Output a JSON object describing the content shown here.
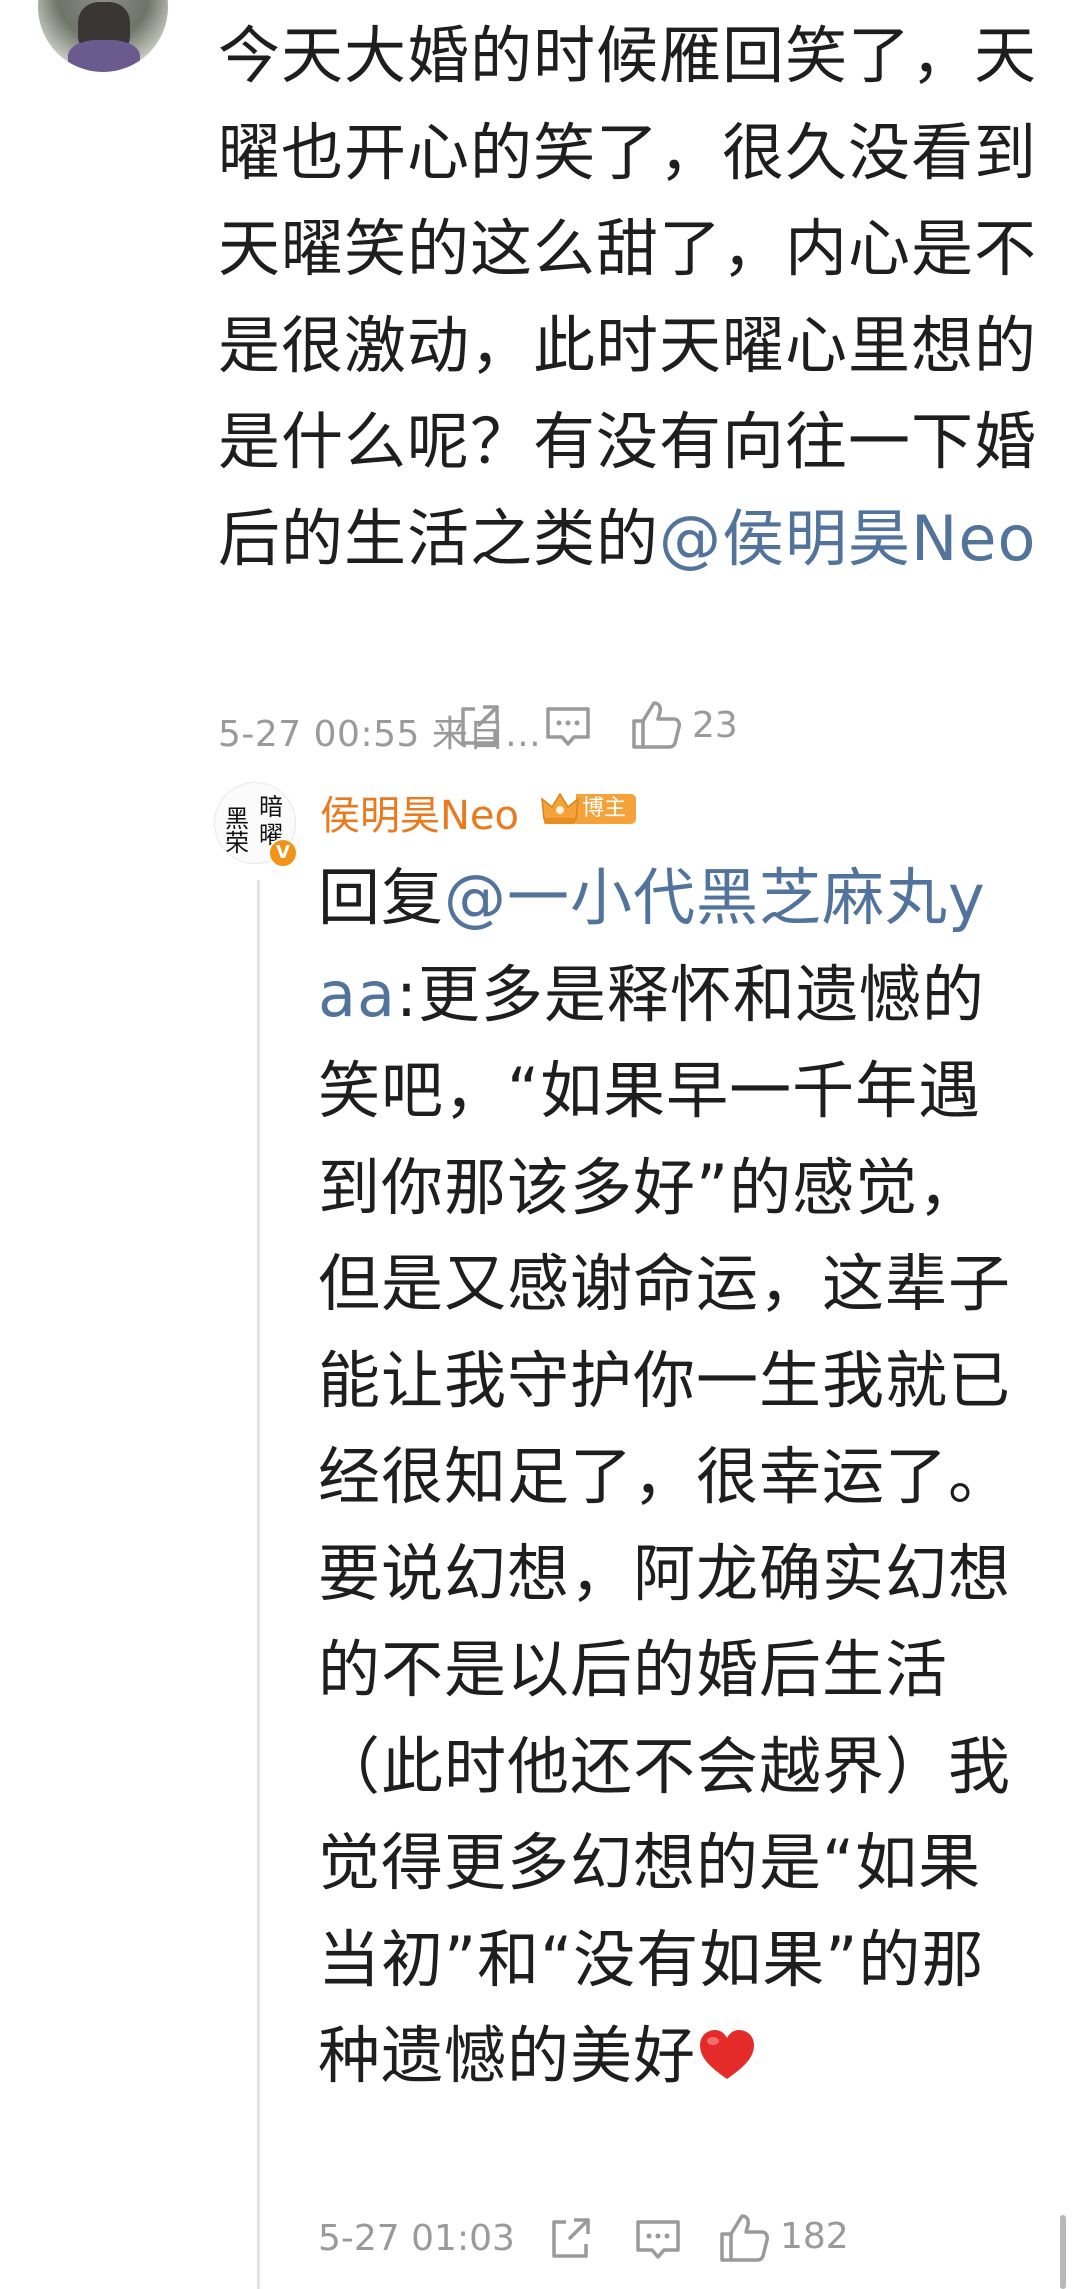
{
  "comment": {
    "text": "今天大婚的时候雁回笑了，天曜也开心的笑了，很久没看到天曜笑的这么甜了，内心是不是很激动，此时天曜心里想的是什么呢？有没有向往一下婚后的生活之类的",
    "mention": "@侯明昊Neo",
    "timestamp": "5-27 00:55",
    "source": "来自…",
    "like_count": "23",
    "icons": [
      "share-icon",
      "comment-icon",
      "like-icon"
    ]
  },
  "reply": {
    "author": "侯明昊Neo",
    "author_badge": "博主",
    "avatar_glyphs": [
      "暗",
      "黑",
      "荣",
      "曜"
    ],
    "verified_mark": "V",
    "reply_prefix": "回复",
    "reply_mention": "@一小代黑芝麻丸yaa",
    "text": ":更多是释怀和遗憾的笑吧，“如果早一千年遇到你那该多好”的感觉，但是又感谢命运，这辈子能让我守护你一生我就已经很知足了，很幸运了。要说幻想，阿龙确实幻想的不是以后的婚后生活（此时他还不会越界）我觉得更多幻想的是“如果当初”和“没有如果”的那种遗憾的美好",
    "emoji": "heart-emoji",
    "timestamp": "5-27 01:03",
    "like_count": "182",
    "icons": [
      "share-icon",
      "comment-icon",
      "like-icon"
    ]
  },
  "colors": {
    "mention": "#52739b",
    "author": "#ea7a1d",
    "meta": "#9a9a9a",
    "heart": "#e52a2a",
    "badge": "#f6a23a"
  }
}
